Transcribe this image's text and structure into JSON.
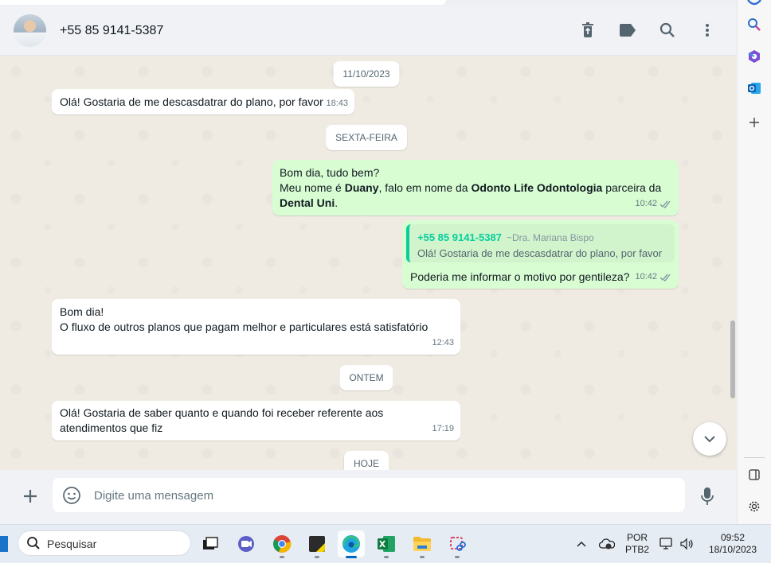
{
  "header": {
    "contact_name": "+55 85 9141-5387",
    "icons": [
      "delete-icon",
      "label-icon",
      "search-icon",
      "menu-icon"
    ]
  },
  "chat": {
    "date_pills": [
      "11/10/2023",
      "SEXTA-FEIRA",
      "ONTEM",
      "HOJE"
    ],
    "messages": [
      {
        "direction": "in",
        "text": "Olá! Gostaria de me descasdatrar do plano, por favor",
        "time": "18:43"
      },
      {
        "direction": "out",
        "line1": "Bom dia, tudo bem?",
        "line2_a": "Meu nome é ",
        "line2_b": "Duany",
        "line2_c": ", falo em nome da ",
        "line2_d": "Odonto Life Odontologia",
        "line2_e": " parceira da",
        "line3_a": "Dental Uni",
        "line3_b": ".",
        "time": "10:42"
      },
      {
        "direction": "out",
        "quote_phone": "+55 85 9141-5387",
        "quote_name": "~Dra. Mariana Bispo",
        "quote_text": "Olá! Gostaria de me descasdatrar do plano, por favor",
        "text": "Poderia me informar o motivo por gentileza?",
        "time": "10:42"
      },
      {
        "direction": "in",
        "line1": "Bom dia!",
        "line2": "O fluxo de outros planos que pagam melhor e particulares está satisfatório",
        "time": "12:43"
      },
      {
        "direction": "in",
        "line1": "Olá! Gostaria de saber quanto e quando foi receber referente aos",
        "line2": "atendimentos que fiz",
        "time": "17:19"
      }
    ]
  },
  "composer": {
    "placeholder": "Digite uma mensagem"
  },
  "taskbar": {
    "search_label": "Pesquisar",
    "lang_line1": "POR",
    "lang_line2": "PTB2",
    "clock_time": "09:52",
    "clock_date": "18/10/2023"
  },
  "colors": {
    "chat_bg": "#efeae2",
    "outgoing_bubble": "#d9fdd3",
    "incoming_bubble": "#ffffff",
    "quote_accent": "#06cf9c",
    "read_tick": "#8696a0"
  }
}
